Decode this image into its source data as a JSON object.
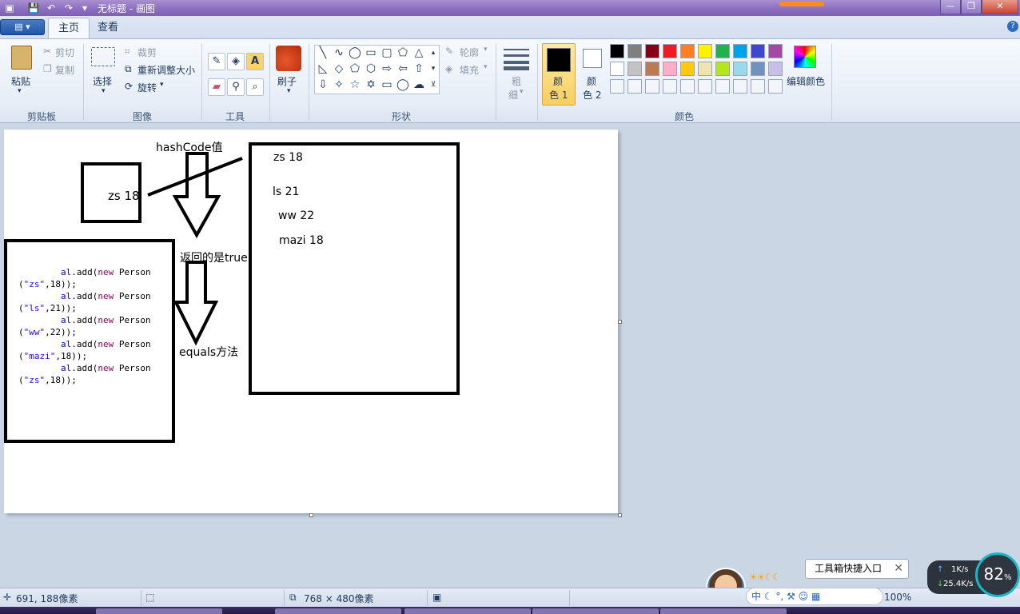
{
  "window": {
    "title": "无标题 - 画图",
    "controls": [
      "minimize",
      "maximize",
      "close"
    ]
  },
  "ribbon": {
    "tabs": [
      "主页",
      "查看"
    ],
    "active_tab": "主页",
    "clipboard": {
      "paste": "粘贴",
      "cut": "剪切",
      "copy": "复制",
      "group": "剪贴板"
    },
    "image": {
      "select": "选择",
      "crop": "裁剪",
      "resize": "重新调整大小",
      "rotate": "旋转",
      "group": "图像"
    },
    "tools": {
      "group": "工具"
    },
    "brushes": {
      "label": "刷子"
    },
    "shapes": {
      "outline": "轮廓",
      "fill": "填充",
      "group": "形状"
    },
    "size": {
      "label_top": "粗",
      "label_bottom": "细"
    },
    "colors": {
      "color1_top": "颜",
      "color1_bottom": "色 1",
      "color2_top": "颜",
      "color2_bottom": "色 2",
      "edit": "编辑颜色",
      "group": "颜色",
      "palette_row1": [
        "#000000",
        "#7f7f7f",
        "#880015",
        "#ed1c24",
        "#ff7f27",
        "#fff200",
        "#22b14c",
        "#00a2e8",
        "#3f48cc",
        "#a349a4"
      ],
      "palette_row2": [
        "#ffffff",
        "#c3c3c3",
        "#b97a57",
        "#ffaec9",
        "#ffc90e",
        "#efe4b0",
        "#b5e61d",
        "#99d9ea",
        "#7092be",
        "#c8bfe7"
      ]
    }
  },
  "canvas": {
    "hashcode_label": "hashCode值",
    "left_box_text": "zs 18",
    "returned_true": "返回的是true",
    "equals_label": "equals方法",
    "right_box_items": [
      "zs 18",
      "ls 21",
      "ww 22",
      "mazi 18"
    ],
    "code_lines": [
      {
        "indent": "        ",
        "obj": "al",
        "method": ".add(",
        "kw": "new",
        "cls": " Person"
      },
      {
        "indent": "",
        "str": "\"zs\"",
        "rest": ",18));"
      },
      {
        "indent": "        ",
        "obj": "al",
        "method": ".add(",
        "kw": "new",
        "cls": " Person"
      },
      {
        "indent": "",
        "str": "\"ls\"",
        "rest": ",21));"
      },
      {
        "indent": "        ",
        "obj": "al",
        "method": ".add(",
        "kw": "new",
        "cls": " Person"
      },
      {
        "indent": "",
        "str": "\"ww\"",
        "rest": ",22));"
      },
      {
        "indent": "        ",
        "obj": "al",
        "method": ".add(",
        "kw": "new",
        "cls": " Person"
      },
      {
        "indent": "",
        "str": "\"mazi\"",
        "rest": ",18));"
      },
      {
        "indent": "        ",
        "obj": "al",
        "method": ".add(",
        "kw": "new",
        "cls": " Person"
      },
      {
        "indent": "",
        "str": "\"zs\"",
        "rest": ",18));"
      }
    ]
  },
  "status": {
    "cursor_pos": "691, 188像素",
    "canvas_size": "768 × 480像素",
    "zoom": "100%"
  },
  "tray": {
    "tooltip": "工具箱快捷入口",
    "ime": "中",
    "net_up": "1K/s",
    "net_down": "25.4K/s",
    "gauge": "82",
    "gauge_unit": "%"
  }
}
